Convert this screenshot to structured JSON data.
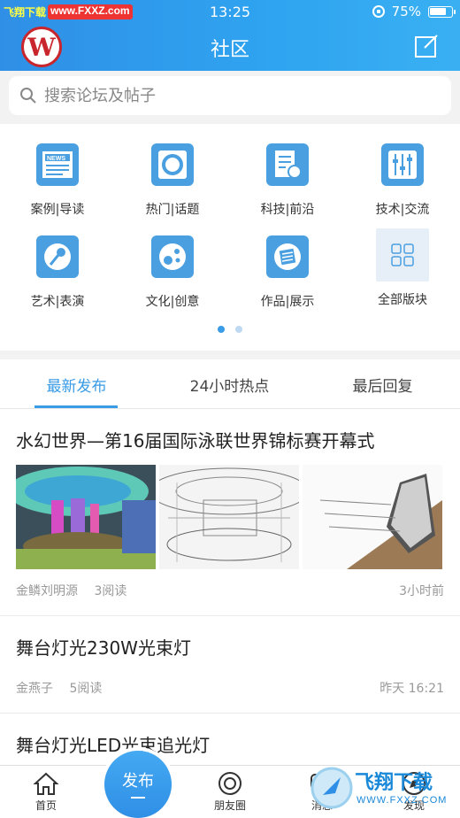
{
  "status_bar": {
    "watermark_left": "飞翔下载",
    "watermark_site": "www.FXXZ.com",
    "time": "13:25",
    "battery": "75%"
  },
  "header": {
    "logo_letter": "W",
    "title": "社区"
  },
  "search": {
    "placeholder": "搜索论坛及帖子"
  },
  "categories": [
    {
      "label": "案例|导读",
      "icon": "news-icon"
    },
    {
      "label": "热门|话题",
      "icon": "hot-topic-icon"
    },
    {
      "label": "科技|前沿",
      "icon": "tech-icon"
    },
    {
      "label": "技术|交流",
      "icon": "mixer-icon"
    },
    {
      "label": "艺术|表演",
      "icon": "microphone-icon"
    },
    {
      "label": "文化|创意",
      "icon": "culture-icon"
    },
    {
      "label": "作品|展示",
      "icon": "works-icon"
    },
    {
      "label": "全部版块",
      "icon": "grid-icon"
    }
  ],
  "pager": {
    "pages": 2,
    "current": 1
  },
  "tabs": [
    {
      "label": "最新发布",
      "active": true
    },
    {
      "label": "24小时热点",
      "active": false
    },
    {
      "label": "最后回复",
      "active": false
    }
  ],
  "posts": [
    {
      "title": "水幻世界—第16届国际泳联世界锦标赛开幕式",
      "author": "金鳞刘明源",
      "reads": "3阅读",
      "time": "3小时前",
      "has_images": true
    },
    {
      "title": "舞台灯光230W光束灯",
      "author": "金燕子",
      "reads": "5阅读",
      "time": "昨天 16:21",
      "has_images": false
    },
    {
      "title": "舞台灯光LED光束追光灯",
      "author": "",
      "reads": "",
      "time": "",
      "has_images": false
    }
  ],
  "bottom_nav": {
    "home": "首页",
    "publish": "发布",
    "moments": "朋友圈",
    "messages": "消息",
    "discover": "发现"
  },
  "watermark_bottom": {
    "text": "飞翔下载",
    "site": "WWW.FXXZ.COM"
  },
  "colors": {
    "accent": "#3a9be6",
    "header_start": "#2f8fe6",
    "header_end": "#3ab0f3",
    "logo_red": "#c8262c"
  }
}
